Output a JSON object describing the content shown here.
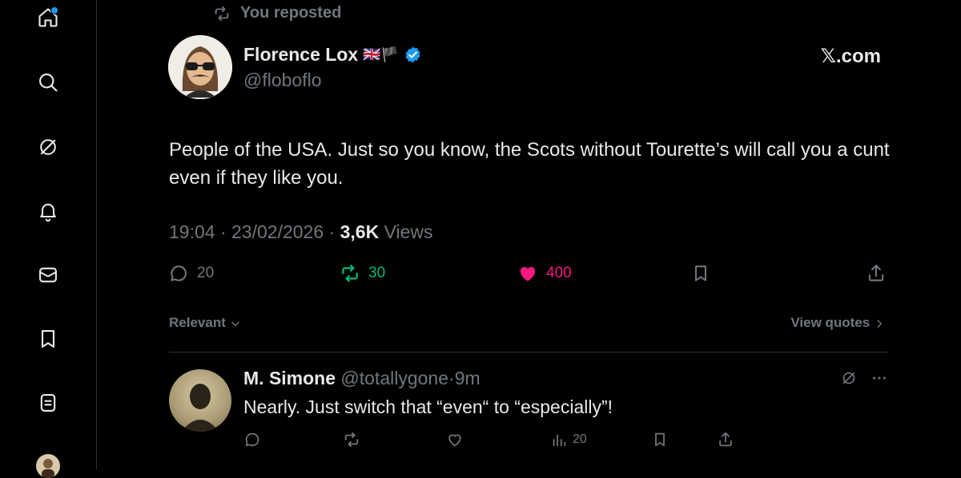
{
  "colors": {
    "background": "#000000",
    "text_primary": "#e7e9ea",
    "text_secondary": "#71767b",
    "accent_blue": "#1d9bf0",
    "retweet_green": "#00ba7c",
    "like_pink": "#f91880"
  },
  "sidebar": {
    "items": [
      {
        "icon": "home-icon",
        "has_notification_dot": true
      },
      {
        "icon": "search-icon"
      },
      {
        "icon": "grok-icon"
      },
      {
        "icon": "bell-icon"
      },
      {
        "icon": "mail-icon"
      },
      {
        "icon": "bookmark-icon"
      },
      {
        "icon": "notes-icon"
      },
      {
        "icon": "profile-avatar"
      }
    ]
  },
  "tweet": {
    "repost_label": "You reposted",
    "author_name": "Florence Lox",
    "author_flags": "🇬🇧🏴",
    "author_handle": "@floboflo",
    "source": "𝕏.com",
    "text": "People of the USA. Just so you know, the Scots without Tourette’s will call you a cunt even if they like you.",
    "time": "19:04",
    "date": "23/02/2026",
    "separator": "·",
    "views_count": "3,6K",
    "views_label": "Views",
    "replies": "20",
    "reposts": "30",
    "likes": "400"
  },
  "replies_header": {
    "sort_label": "Relevant",
    "view_quotes_label": "View quotes"
  },
  "reply": {
    "name": "M. Simone",
    "handle": "@totallygone",
    "separator": "·",
    "time": "9m",
    "text": "Nearly. Just switch that “even“ to “especially”!",
    "views": "20"
  }
}
